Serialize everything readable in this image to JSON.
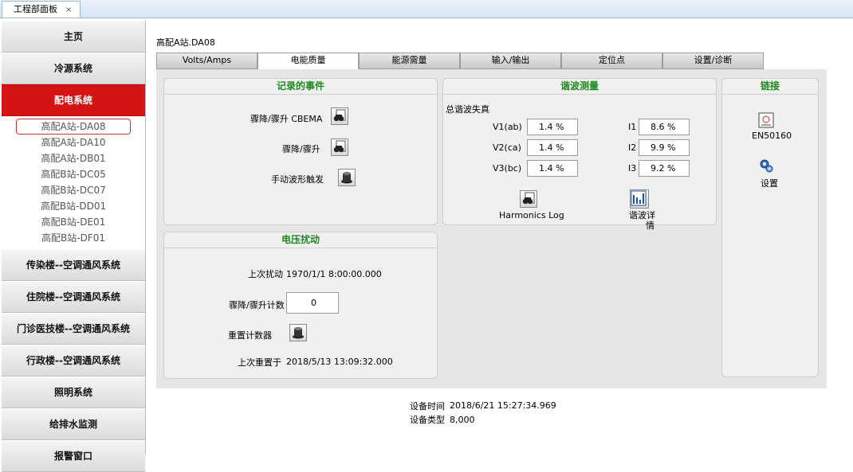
{
  "doc_tab": {
    "title": "工程部面板",
    "close": "×"
  },
  "sidebar": {
    "sections_top": [
      {
        "label": "主页"
      },
      {
        "label": "冷源系统"
      },
      {
        "label": "配电系统"
      }
    ],
    "stations": [
      "高配A站-DA08",
      "高配A站-DA10",
      "高配A站-DB01",
      "高配B站-DC05",
      "高配B站-DC07",
      "高配B站-DD01",
      "高配B站-DE01",
      "高配B站-DF01"
    ],
    "sections_bottom": [
      {
        "label": "传染楼--空调通风系统"
      },
      {
        "label": "住院楼--空调通风系统"
      },
      {
        "label": "门诊医技楼--空调通风系统"
      },
      {
        "label": "行政楼--空调通风系统"
      },
      {
        "label": "照明系统"
      },
      {
        "label": "给排水监测"
      },
      {
        "label": "报警窗口"
      }
    ]
  },
  "station_label": "高配A站.DA08",
  "tabs": [
    "Volts/Amps",
    "电能质量",
    "能源需量",
    "输入/输出",
    "定位点",
    "设置/诊断"
  ],
  "events_panel": {
    "title": "记录的事件",
    "cbema_label": "骤降/骤升 CBEMA",
    "sag_swell_label": "骤降/骤升",
    "manual_trigger_label": "手动波形触发"
  },
  "harmonics_panel": {
    "title": "谐波测量",
    "thd_label": "总谐波失真",
    "rows": [
      {
        "v_label": "V1(ab)",
        "v_value": "1.4 %",
        "i_label": "I1",
        "i_value": "8.6 %"
      },
      {
        "v_label": "V2(ca)",
        "v_value": "1.4 %",
        "i_label": "I2",
        "i_value": "9.9 %"
      },
      {
        "v_label": "V3(bc)",
        "v_value": "1.4 %",
        "i_label": "I3",
        "i_value": "9.2 %"
      }
    ],
    "log_label": "Harmonics Log",
    "detail_label_1": "谐波详",
    "detail_label_2": "情"
  },
  "links_panel": {
    "title": "链接",
    "en50160_label": "EN50160",
    "settings_label": "设置"
  },
  "voltage_panel": {
    "title": "电压扰动",
    "last_disturb_label": "上次扰动",
    "last_disturb_value": "1970/1/1 8:00:00.000",
    "count_label": "骤降/骤升计数",
    "count_value": "0",
    "reset_label": "重置计数器",
    "last_reset_label": "上次重置于",
    "last_reset_value": "2018/5/13 13:09:32.000"
  },
  "footer": {
    "device_time_label": "设备时间",
    "device_time_value": "2018/6/21 15:27:34.969",
    "device_type_label": "设备类型",
    "device_type_value": "8,000"
  },
  "colors": {
    "accent_red": "#d41414",
    "title_green": "#1d8a1d"
  }
}
